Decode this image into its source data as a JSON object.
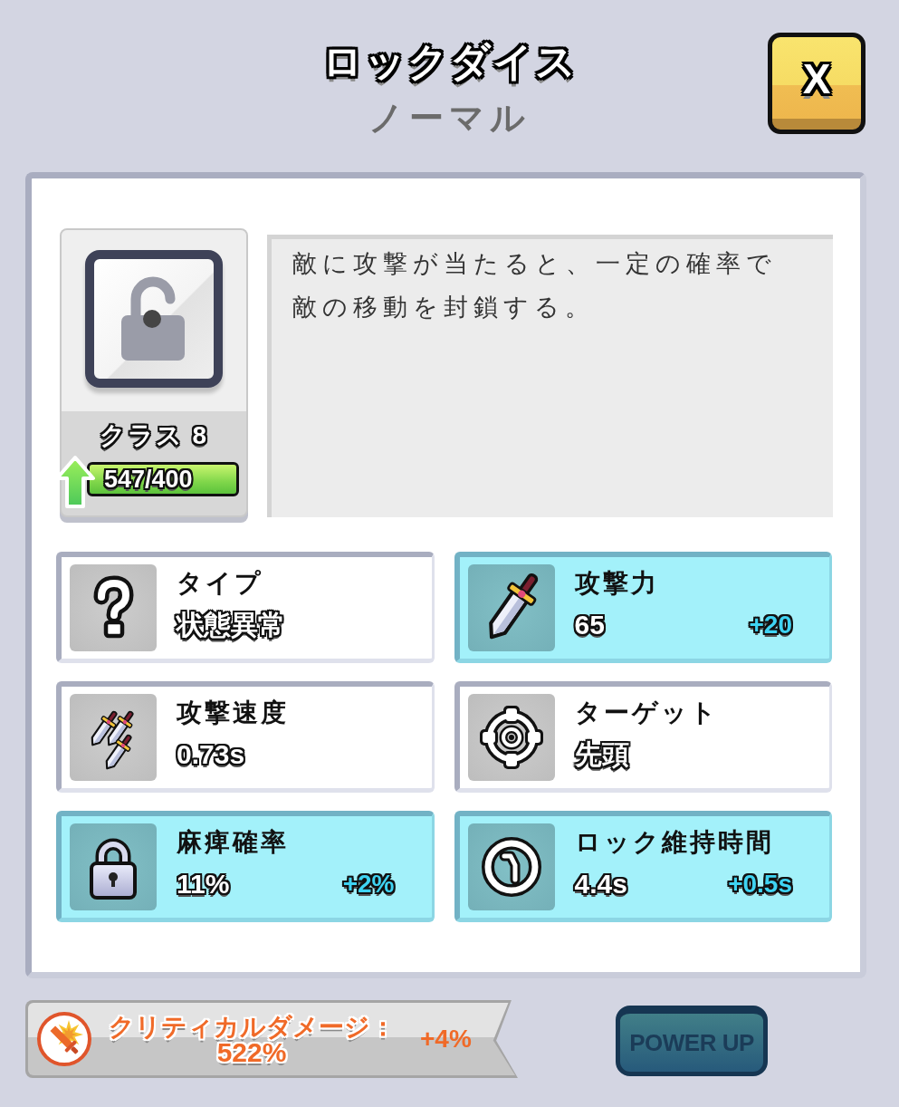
{
  "header": {
    "title": "ロックダイス",
    "rarity": "ノーマル"
  },
  "close_button": {
    "label": "X"
  },
  "dice": {
    "class_label": "クラス 8",
    "progress": {
      "reading": "547/400",
      "level": 1
    },
    "upgrade_ready": true
  },
  "description": "敵に攻撃が当たると、一定の確率で敵の移動を封鎖する。",
  "stats": [
    {
      "label": "タイプ",
      "value": "状態異常",
      "boosted": false
    },
    {
      "label": "攻撃力",
      "value": "65",
      "bonus": "+20",
      "boosted": true
    },
    {
      "label": "攻撃速度",
      "value": "0.73s",
      "boosted": false
    },
    {
      "label": "ターゲット",
      "value": "先頭",
      "boosted": false
    },
    {
      "label": "麻痺確率",
      "value": "11%",
      "bonus": "+2%",
      "boosted": true
    },
    {
      "label": "ロック維持時間",
      "value": "4.4s",
      "bonus": "+0.5s",
      "boosted": true
    }
  ],
  "critical_bonus": {
    "label": "クリティカルダメージ：",
    "value": "522%",
    "bonus": "+4%"
  },
  "power_up_button": {
    "label": "POWER UP",
    "disabled": true
  }
}
